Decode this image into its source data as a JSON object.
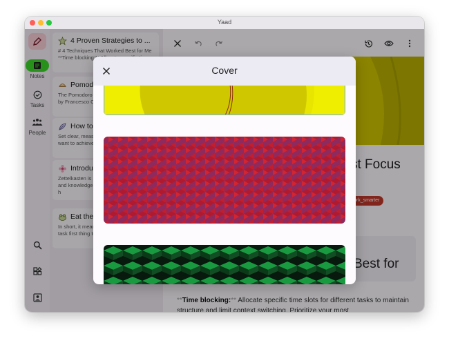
{
  "window": {
    "title": "Yaad"
  },
  "rail": {
    "items": [
      {
        "label": "Notes",
        "icon": "notes-icon",
        "active": true
      },
      {
        "label": "Tasks",
        "icon": "tasks-icon",
        "active": false
      },
      {
        "label": "People",
        "icon": "people-icon",
        "active": false
      }
    ],
    "bottom_icons": [
      "search-icon",
      "widgets-icon",
      "account-icon"
    ]
  },
  "notes": [
    {
      "title": "4 Proven Strategies to ...",
      "snippet": "# 4 Techniques That Worked Best for Me **Time blocking:** Allocate specific time",
      "icon": "star-icon"
    },
    {
      "title": "Pomodoro",
      "snippet": "The Pomodoro Technique was developed by Francesco Cirillo, a time management",
      "icon": "tomato-icon"
    },
    {
      "title": "How to",
      "snippet": "Set clear, measurable goals for what you want to achieve in key areas of your",
      "icon": "feather-icon"
    },
    {
      "title": "Introduction",
      "snippet": "Zettelkasten is a method of note taking and knowledge management system that h",
      "icon": "flower-icon"
    },
    {
      "title": "Eat the",
      "snippet": "In short, it means tackling your biggest task first thing to avoid the mental",
      "icon": "frog-icon"
    }
  ],
  "editor": {
    "heading_1": "st Focus",
    "tag": "ork_smarter",
    "heading_2": "Best for",
    "body_bold": "Time blocking:",
    "body_marker": "**",
    "body_text": " Allocate specific time slots for different tasks to maintain structure and limit context switching. Prioritize your most"
  },
  "modal": {
    "title": "Cover"
  },
  "colors": {
    "accent": "#3bd62a",
    "tag": "#c0392b",
    "cover_yellow": "#d1c700"
  }
}
